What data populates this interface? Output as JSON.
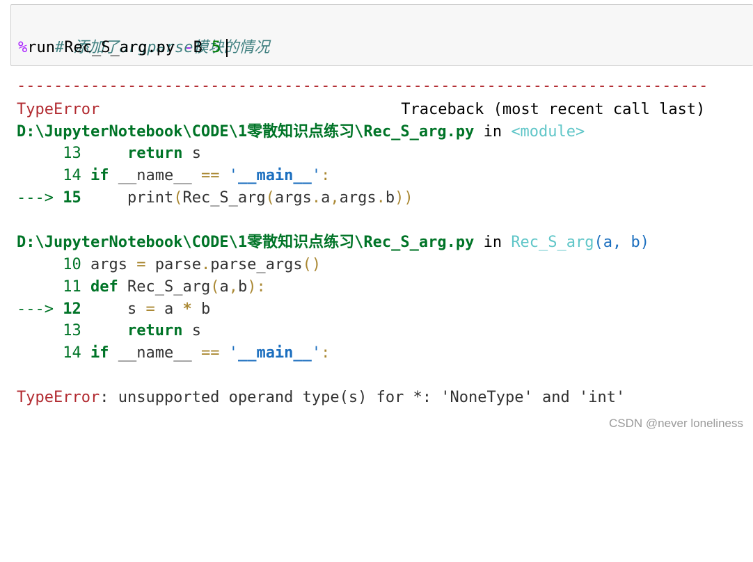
{
  "input": {
    "comment": "# 添加了argparse模块的情况",
    "magic": "%",
    "command": "run Rec_S_arg.py ",
    "flag_op": "-",
    "flag": "B ",
    "value": "5"
  },
  "output": {
    "separator": "---------------------------------------------------------------------------",
    "error_type": "TypeError",
    "traceback_header": "Traceback (most recent call last)",
    "frames": [
      {
        "path": "D:\\JupyterNotebook\\CODE\\1零散知识点练习\\Rec_S_arg.py",
        "in_word": " in ",
        "location": "<module>",
        "location_args": "",
        "lines": [
          {
            "prefix": "     ",
            "no": "13",
            "code": "     return s"
          },
          {
            "prefix": "     ",
            "no": "14",
            "code": " if __name__ == '__main__':"
          },
          {
            "prefix": "---> ",
            "no": "15",
            "code": "     print(Rec_S_arg(args.a,args.b))"
          }
        ]
      },
      {
        "path": "D:\\JupyterNotebook\\CODE\\1零散知识点练习\\Rec_S_arg.py",
        "in_word": " in ",
        "location": "Rec_S_arg",
        "location_args": "(a, b)",
        "lines": [
          {
            "prefix": "     ",
            "no": "10",
            "code": " args = parse.parse_args()"
          },
          {
            "prefix": "     ",
            "no": "11",
            "code": " def Rec_S_arg(a,b):"
          },
          {
            "prefix": "---> ",
            "no": "12",
            "code": "     s = a * b"
          },
          {
            "prefix": "     ",
            "no": "13",
            "code": "     return s"
          },
          {
            "prefix": "     ",
            "no": "14",
            "code": " if __name__ == '__main__':"
          }
        ]
      }
    ],
    "final_error": "TypeError",
    "final_message": ": unsupported operand type(s) for *: 'NoneType' and 'int'"
  },
  "watermark": "CSDN @never  loneliness"
}
